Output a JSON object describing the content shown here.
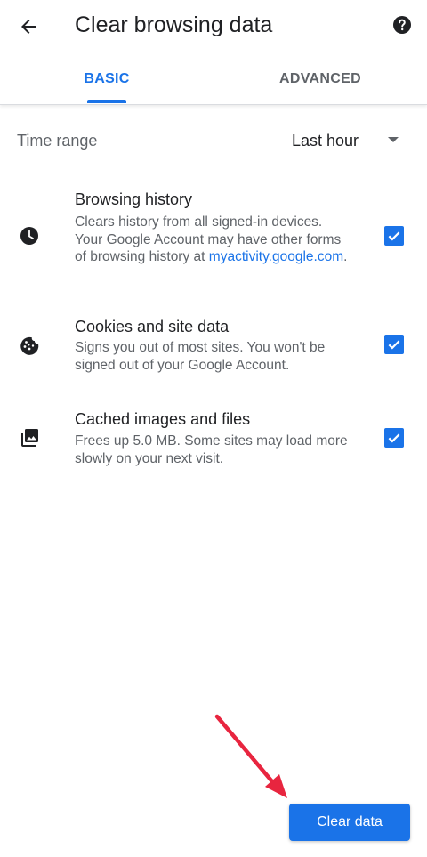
{
  "header": {
    "title": "Clear browsing data",
    "back_icon": "arrow-back-icon",
    "help_icon": "help-icon"
  },
  "tabs": [
    {
      "label": "BASIC",
      "selected": true
    },
    {
      "label": "ADVANCED",
      "selected": false
    }
  ],
  "time_range": {
    "label": "Time range",
    "value": "Last hour"
  },
  "items": [
    {
      "title": "Browsing history",
      "description": "Clears history from all signed-in devices. Your Google Account may have other forms of browsing history at",
      "link": "myactivity.google.com",
      "link_suffix": ".",
      "icon": "clock-icon",
      "checked": true
    },
    {
      "title": "Cookies and site data",
      "description": "Signs you out of most sites. You won't be signed out of your Google Account.",
      "icon": "cookie-icon",
      "checked": true
    },
    {
      "title": "Cached images and files",
      "description": "Frees up 5.0 MB. Some sites may load more slowly on your next visit.",
      "icon": "images-icon",
      "checked": true
    }
  ],
  "actions": {
    "clear_label": "Clear data"
  },
  "colors": {
    "accent": "#1a73e8",
    "annotation_arrow": "#e8253f"
  }
}
